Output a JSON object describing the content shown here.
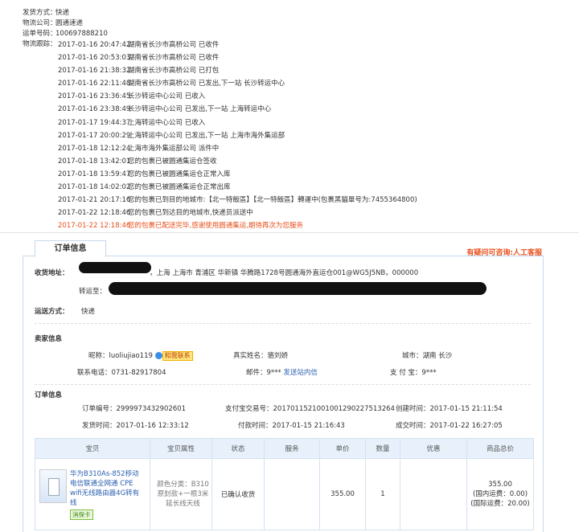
{
  "shipping": {
    "rows": [
      {
        "label": "发货方式：",
        "value": "快递"
      },
      {
        "label": "物流公司：",
        "value": "圆通速递"
      },
      {
        "label": "运单号码：",
        "value": "100697888210"
      }
    ],
    "tracking_label": "物流跟踪：",
    "tracking": [
      {
        "time": "2017-01-16 20:47:42",
        "text": "湖南省长沙市高桥公司 已收件"
      },
      {
        "time": "2017-01-16 20:53:03",
        "text": "湖南省长沙市高桥公司 已收件"
      },
      {
        "time": "2017-01-16 21:38:32",
        "text": "湖南省长沙市高桥公司 已打包"
      },
      {
        "time": "2017-01-16 22:11:48",
        "text": "湖南省长沙市高桥公司 已发出,下一站 长沙转运中心"
      },
      {
        "time": "2017-01-16 23:36:45",
        "text": "长沙转运中心公司 已收入"
      },
      {
        "time": "2017-01-16 23:38:49",
        "text": "长沙转运中心公司 已发出,下一站 上海转运中心"
      },
      {
        "time": "2017-01-17 19:44:37",
        "text": "上海转运中心公司 已收入"
      },
      {
        "time": "2017-01-17 20:00:29",
        "text": "上海转运中心公司 已发出,下一站 上海市海外集运部"
      },
      {
        "time": "2017-01-18 12:12:24",
        "text": "上海市海外集运部公司 派件中"
      },
      {
        "time": "2017-01-18 13:42:01",
        "text": "您的包裹已被圆通集运仓签收"
      },
      {
        "time": "2017-01-18 13:59:47",
        "text": "您的包裹已被圆通集运仓正常入库"
      },
      {
        "time": "2017-01-18 14:02:02",
        "text": "您的包裹已被圆通集运仓正常出库"
      },
      {
        "time": "2017-01-21 20:17:16",
        "text": "您的包裹已到目的地城市:【北一特飯區】【北一特飯區】轉運中(包裹黑貓單号为:7455364800)"
      },
      {
        "time": "2017-01-22 12:18:46",
        "text": "您的包裹已到达目的地城市,快递员派送中"
      },
      {
        "time": "2017-01-22 12:18:46",
        "text": "您的包裹已配送完毕,感谢使用圆通集运,期待再次为您服务"
      }
    ]
  },
  "order_tab": "订单信息",
  "help_link": "有疑问可咨询:人工客服",
  "receiver": {
    "address_label": "收货地址：",
    "address_value": "，上海 上海市 青浦区 华新镇 华腾路1728号圆通海外直运仓001@WG5J5NB，000000",
    "transfer_label": "转运至：",
    "delivery_label": "运送方式：",
    "delivery_value": "快递"
  },
  "seller": {
    "title": "卖家信息",
    "nick_label": "昵称：",
    "nick_value": "luoliujiao119",
    "contact_badge": "和我联系",
    "realname_label": "真实姓名：",
    "realname_value": "骆刘娇",
    "city_label": "城市：",
    "city_value": "湖南 长沙",
    "phone_label": "联系电话：",
    "phone_value": "0731-82917804",
    "email_label": "邮件：",
    "email_value": "9***",
    "email_link": "发送站内信",
    "alipay_label": "支 付 宝：",
    "alipay_value": "9***"
  },
  "order": {
    "title": "订单信息",
    "no_label": "订单编号：",
    "no_value": "2999973432902601",
    "alipay_no_label": "支付宝交易号：",
    "alipay_no_value": "2017011521001001290227513264",
    "created_label": "创建时间：",
    "created_value": "2017-01-15 21:11:54",
    "ship_label": "发货时间：",
    "ship_value": "2017-01-16 12:33:12",
    "paid_label": "付款时间：",
    "paid_value": "2017-01-15 21:16:43",
    "done_label": "成交时间：",
    "done_value": "2017-01-22 16:27:05"
  },
  "items_table": {
    "headers": [
      "宝贝",
      "宝贝属性",
      "状态",
      "服务",
      "单价",
      "数量",
      "优惠",
      "商品总价"
    ],
    "item": {
      "title": "华为B310As-852移动电信联通全网通 CPE wifi无线路由器4G转有线",
      "guarantee": "消保卡",
      "attr": "颜色分类：B310原封款+一根3米延长线天线",
      "status": "已确认收货",
      "service": "",
      "price": "355.00",
      "qty": "1",
      "discount": "",
      "total": "355.00",
      "domestic": "(国内运费：0.00)",
      "intl": "(国际运费：20.00)"
    }
  }
}
